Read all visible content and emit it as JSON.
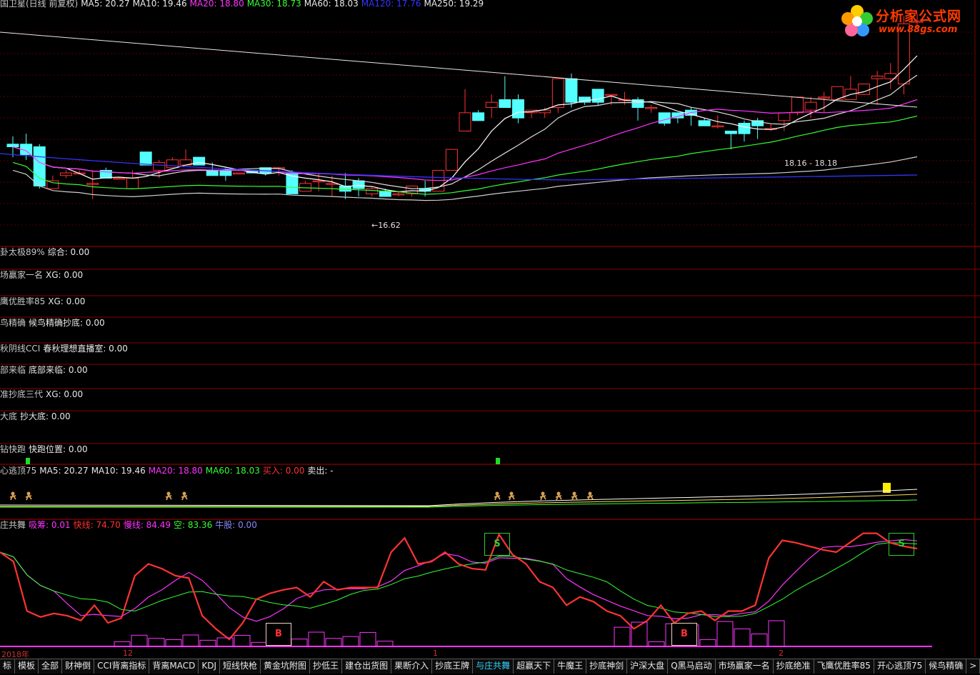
{
  "price_panel": {
    "title": [
      {
        "text": "国卫星(日线 前复权)",
        "color": "#c8c8c8"
      },
      {
        "text": "MA5: 20.27",
        "color": "#e8e8e8"
      },
      {
        "text": "MA10: 19.46",
        "color": "#e8e8e8"
      },
      {
        "text": "MA20: 18.80",
        "color": "#ff33ff"
      },
      {
        "text": "MA30: 18.73",
        "color": "#33ff33"
      },
      {
        "text": "MA60: 18.03",
        "color": "#e8e8e8"
      },
      {
        "text": "MA120: 17.76",
        "color": "#3333ff"
      },
      {
        "text": "MA250: 19.29",
        "color": "#e8e8e8"
      }
    ],
    "low_label": "←16.62",
    "range_label": "18.16 - 18.18"
  },
  "logo": {
    "name": "分析家公式网",
    "url": "www.88gs.com",
    "icon": "flower-icon"
  },
  "indicator_rows": [
    {
      "title": "卦太极89%",
      "line": "综合: 0.00"
    },
    {
      "title": "场赢家一名",
      "line": "XG: 0.00"
    },
    {
      "title": "鹰优胜率85",
      "line": "XG: 0.00"
    },
    {
      "title": "鸟精确",
      "line": "候鸟精确抄底: 0.00"
    },
    {
      "title": "秋阴线CCI",
      "line": "春秋理想直播室: 0.00"
    },
    {
      "title": "部来临",
      "line": "底部来临: 0.00"
    },
    {
      "title": "准抄底三代",
      "line": "XG: 0.00"
    },
    {
      "title": "大底",
      "line": "抄大底: 0.00"
    },
    {
      "title": "钻快跑",
      "line": "快跑位置: 0.00"
    }
  ],
  "escape_panel": {
    "title": "心逃顶75",
    "values": [
      {
        "text": "MA5: 20.27",
        "color": "#e8e8e8"
      },
      {
        "text": "MA10: 19.46",
        "color": "#e8e8e8"
      },
      {
        "text": "MA20: 18.80",
        "color": "#ff33ff"
      },
      {
        "text": "MA60: 18.03",
        "color": "#33ff33"
      },
      {
        "text": "买入: 0.00",
        "color": "#ff3333"
      },
      {
        "text": "卖出: -",
        "color": "#e8e8e8"
      }
    ]
  },
  "dance_panel": {
    "title": "庄共舞",
    "values": [
      {
        "text": "吸筹: 0.01",
        "color": "#ff33ff"
      },
      {
        "text": "快线: 74.70",
        "color": "#ff3333"
      },
      {
        "text": "慢线: 84.49",
        "color": "#ff33ff"
      },
      {
        "text": "空: 83.36",
        "color": "#33ff33"
      },
      {
        "text": "牛股: 0.00",
        "color": "#8888ff"
      }
    ],
    "buy_label": "B",
    "sell_label": "S"
  },
  "time_axis": [
    {
      "label": "2018年"
    },
    {
      "label": "12"
    },
    {
      "label": "1"
    },
    {
      "label": "2"
    }
  ],
  "tabs": [
    "标",
    "模板",
    "全部",
    "财神倒",
    "CCI背离指标",
    "背离MACD",
    "KDJ",
    "短线快枪",
    "黄金坑附图",
    "抄低王",
    "建仓出货图",
    "果断介入",
    "抄底王牌",
    "与庄共舞",
    "超赢天下",
    "牛魔王",
    "抄底神剑",
    "沪深大盘",
    "Q黑马启动",
    "市场赢家一名",
    "抄底绝准",
    "飞鹰优胜率85",
    "开心逃顶75",
    "候鸟精确",
    ">"
  ],
  "active_tab": "与庄共舞",
  "colors": {
    "up": "#ff3232",
    "down": "#54ffff",
    "grid": "#7a0000",
    "ma5": "#ffffff",
    "ma20": "#ff33ff",
    "ma30": "#33ff33",
    "ma120": "#3333ff"
  },
  "chart_data": {
    "type": "candlestick",
    "candles": [
      [
        19.6,
        19.9,
        19.1,
        19.5
      ],
      [
        19.6,
        20.0,
        19.0,
        19.2
      ],
      [
        19.5,
        19.6,
        17.9,
        18.0
      ],
      [
        17.9,
        18.4,
        17.9,
        18.2
      ],
      [
        18.4,
        18.6,
        18.3,
        18.5
      ],
      [
        18.5,
        18.6,
        18.5,
        18.5
      ],
      [
        18.1,
        18.6,
        17.5,
        18.1
      ],
      [
        18.6,
        18.7,
        18.3,
        18.3
      ],
      [
        18.3,
        18.3,
        18.3,
        18.3
      ],
      [
        17.9,
        18.6,
        17.9,
        18.3
      ],
      [
        19.3,
        19.3,
        18.8,
        18.8
      ],
      [
        18.6,
        19.0,
        18.3,
        18.9
      ],
      [
        18.7,
        19.1,
        18.7,
        19.0
      ],
      [
        18.8,
        19.4,
        18.8,
        19.0
      ],
      [
        19.1,
        19.1,
        18.8,
        18.8
      ],
      [
        18.6,
        18.9,
        18.4,
        18.4
      ],
      [
        18.6,
        18.7,
        18.2,
        18.4
      ],
      [
        18.5,
        18.5,
        18.5,
        18.5
      ],
      [
        18.6,
        18.6,
        18.5,
        18.5
      ],
      [
        18.7,
        18.7,
        18.4,
        18.5
      ],
      [
        18.7,
        18.7,
        18.4,
        18.7
      ],
      [
        18.5,
        18.6,
        18.2,
        17.7
      ],
      [
        17.8,
        18.2,
        17.8,
        18.1
      ],
      [
        18.2,
        18.5,
        17.8,
        18.2
      ],
      [
        18.1,
        18.4,
        17.6,
        18.1
      ],
      [
        18.0,
        18.5,
        17.5,
        17.8
      ],
      [
        18.2,
        18.3,
        17.6,
        17.9
      ],
      [
        17.7,
        18.0,
        17.6,
        17.9
      ],
      [
        17.8,
        17.9,
        17.6,
        17.6
      ],
      [
        17.7,
        17.8,
        17.6,
        17.7
      ],
      [
        17.7,
        18.0,
        17.6,
        18.0
      ],
      [
        17.9,
        18.2,
        17.6,
        17.8
      ],
      [
        17.8,
        18.5,
        17.8,
        18.6
      ],
      [
        18.6,
        19.4,
        18.6,
        19.4
      ],
      [
        20.1,
        21.7,
        20.1,
        20.8
      ],
      [
        20.8,
        20.9,
        20.5,
        20.5
      ],
      [
        21.0,
        21.5,
        20.6,
        21.2
      ],
      [
        21.3,
        22.2,
        21.2,
        21.0
      ],
      [
        21.3,
        21.5,
        20.4,
        20.6
      ],
      [
        20.8,
        20.9,
        20.6,
        20.9
      ],
      [
        20.8,
        21.0,
        20.6,
        20.9
      ],
      [
        21.0,
        22.0,
        20.8,
        22.1
      ],
      [
        22.1,
        22.3,
        21.0,
        21.2
      ],
      [
        21.4,
        21.4,
        21.1,
        21.2
      ],
      [
        21.7,
        21.7,
        21.1,
        21.2
      ],
      [
        21.5,
        21.5,
        21.1,
        21.5
      ],
      [
        21.3,
        21.6,
        21.1,
        21.3
      ],
      [
        21.3,
        21.4,
        20.5,
        21.0
      ],
      [
        21.0,
        21.1,
        20.8,
        21.0
      ],
      [
        20.8,
        20.8,
        20.3,
        20.4
      ],
      [
        20.8,
        20.8,
        20.4,
        20.6
      ],
      [
        20.9,
        21.0,
        20.3,
        20.7
      ],
      [
        20.5,
        20.6,
        20.3,
        20.3
      ],
      [
        20.3,
        20.7,
        20.2,
        20.3
      ],
      [
        20.1,
        20.1,
        19.4,
        20.0
      ],
      [
        20.4,
        20.5,
        19.7,
        20.0
      ],
      [
        20.5,
        20.6,
        19.8,
        20.3
      ],
      [
        20.2,
        20.4,
        20.1,
        20.2
      ],
      [
        20.5,
        20.7,
        20.1,
        20.8
      ],
      [
        20.8,
        21.4,
        20.7,
        21.4
      ],
      [
        20.9,
        21.4,
        20.6,
        21.2
      ],
      [
        21.4,
        21.6,
        20.8,
        21.4
      ],
      [
        21.3,
        21.8,
        21.3,
        21.8
      ],
      [
        21.3,
        22.2,
        21.3,
        21.7
      ],
      [
        21.5,
        21.9,
        21.5,
        21.9
      ],
      [
        22.1,
        22.4,
        21.1,
        22.2
      ],
      [
        22.1,
        22.7,
        21.7,
        22.3
      ],
      [
        21.9,
        24.5,
        21.5,
        24.2
      ],
      [
        24.3,
        24.6,
        24.0,
        24.3
      ]
    ]
  }
}
